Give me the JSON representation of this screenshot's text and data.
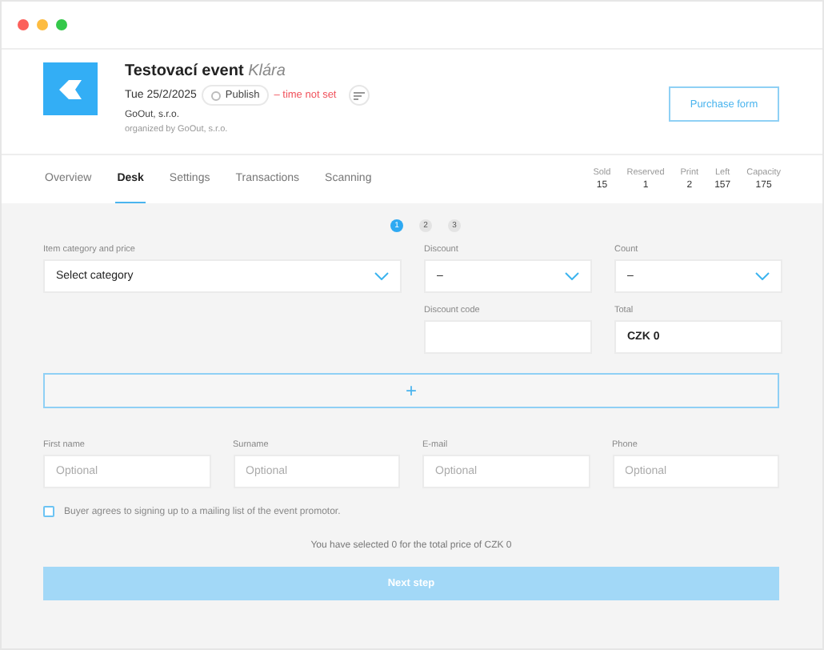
{
  "event": {
    "title": "Testovací event",
    "subtitle": "Klára",
    "date": "Tue 25/2/2025",
    "publish": "Publish",
    "time_note": "– time not set",
    "organizer": "GoOut, s.r.o.",
    "organized_by": "organized by GoOut, s.r.o.",
    "purchase_form": "Purchase form"
  },
  "tabs": [
    {
      "label": "Overview",
      "selected": false
    },
    {
      "label": "Desk",
      "selected": true
    },
    {
      "label": "Settings",
      "selected": false
    },
    {
      "label": "Transactions",
      "selected": false
    },
    {
      "label": "Scanning",
      "selected": false
    }
  ],
  "stats": [
    {
      "label": "Sold",
      "value": "15"
    },
    {
      "label": "Reserved",
      "value": "1"
    },
    {
      "label": "Print",
      "value": "2"
    },
    {
      "label": "Left",
      "value": "157"
    },
    {
      "label": "Capacity",
      "value": "175"
    }
  ],
  "steps": [
    {
      "label": "1",
      "selected": true
    },
    {
      "label": "2",
      "selected": false
    },
    {
      "label": "3",
      "selected": false
    }
  ],
  "category": {
    "label": "Item category and price",
    "value": "Select category"
  },
  "discount": {
    "label": "Discount",
    "value": "–"
  },
  "count": {
    "label": "Count",
    "value": "–"
  },
  "discount_code": {
    "label": "Discount code"
  },
  "total": {
    "label": "Total",
    "value": "CZK 0"
  },
  "add_button": "+",
  "person_fields": [
    {
      "label": "First name",
      "placeholder": "Optional"
    },
    {
      "label": "Surname",
      "placeholder": "Optional"
    },
    {
      "label": "E-mail",
      "placeholder": "Optional"
    },
    {
      "label": "Phone",
      "placeholder": "Optional"
    }
  ],
  "mailing_consent": {
    "label": "Buyer agrees to signing up to a mailing list of the event promotor.",
    "checked": false
  },
  "summary": "You have selected 0 for the total price of CZK 0",
  "next_button": {
    "label": "Next step",
    "disabled": true
  }
}
